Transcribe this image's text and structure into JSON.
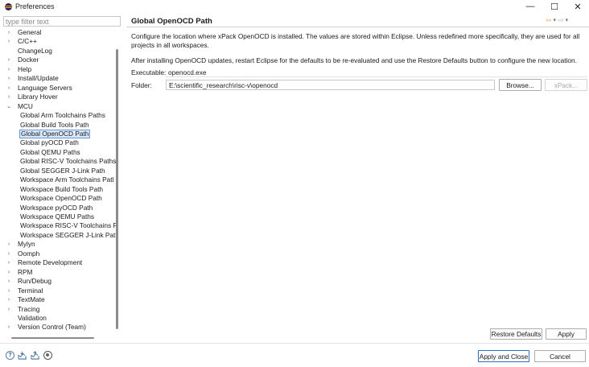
{
  "window": {
    "title": "Preferences",
    "minimize": "—",
    "maximize": "☐",
    "close": "✕"
  },
  "filter": {
    "placeholder": "type filter text"
  },
  "tree": [
    {
      "label": "General",
      "expandable": true
    },
    {
      "label": "C/C++",
      "expandable": true
    },
    {
      "label": "ChangeLog",
      "expandable": false
    },
    {
      "label": "Docker",
      "expandable": true
    },
    {
      "label": "Help",
      "expandable": true
    },
    {
      "label": "Install/Update",
      "expandable": true
    },
    {
      "label": "Language Servers",
      "expandable": true
    },
    {
      "label": "Library Hover",
      "expandable": true
    },
    {
      "label": "MCU",
      "expandable": true,
      "expanded": true,
      "children": [
        "Global Arm Toolchains Paths",
        "Global Build Tools Path",
        "Global OpenOCD Path",
        "Global pyOCD Path",
        "Global QEMU Paths",
        "Global RISC-V Toolchains Paths",
        "Global SEGGER J-Link Path",
        "Workspace Arm Toolchains Patl",
        "Workspace Build Tools Path",
        "Workspace OpenOCD Path",
        "Workspace pyOCD Path",
        "Workspace QEMU Paths",
        "Workspace RISC-V Toolchains P",
        "Workspace SEGGER J-Link Path"
      ],
      "selected_child": "Global OpenOCD Path"
    },
    {
      "label": "Mylyn",
      "expandable": true
    },
    {
      "label": "Oomph",
      "expandable": true
    },
    {
      "label": "Remote Development",
      "expandable": true
    },
    {
      "label": "RPM",
      "expandable": true
    },
    {
      "label": "Run/Debug",
      "expandable": true
    },
    {
      "label": "Terminal",
      "expandable": true
    },
    {
      "label": "TextMate",
      "expandable": true
    },
    {
      "label": "Tracing",
      "expandable": true
    },
    {
      "label": "Validation",
      "expandable": false
    },
    {
      "label": "Version Control (Team)",
      "expandable": true
    }
  ],
  "page": {
    "title": "Global OpenOCD Path",
    "description": "Configure the location where xPack OpenOCD is installed. The values are stored within Eclipse. Unless redefined more specifically, they are used for all projects in all workspaces.",
    "note": "After installing OpenOCD updates, restart Eclipse for the defaults to be re-evaluated and use the Restore Defaults button to configure the new location.",
    "executable_label": "Executable:",
    "executable_value": "openocd.exe",
    "folder_label": "Folder:",
    "folder_value": "E:\\scientific_research\\risc-v\\openocd",
    "browse_label": "Browse...",
    "xpack_label": "xPack..."
  },
  "actions": {
    "restore_defaults": "Restore Defaults",
    "apply": "Apply",
    "apply_close": "Apply and Close",
    "cancel": "Cancel"
  },
  "icons": {
    "help": "help-icon",
    "import": "import-icon",
    "export": "export-icon",
    "preferences": "record-icon"
  },
  "colors": {
    "selection_bg": "#d9e8fb",
    "selection_border": "#6a9bd6",
    "primary_border": "#2b6fbd",
    "nav_back": "#e8a23a"
  }
}
